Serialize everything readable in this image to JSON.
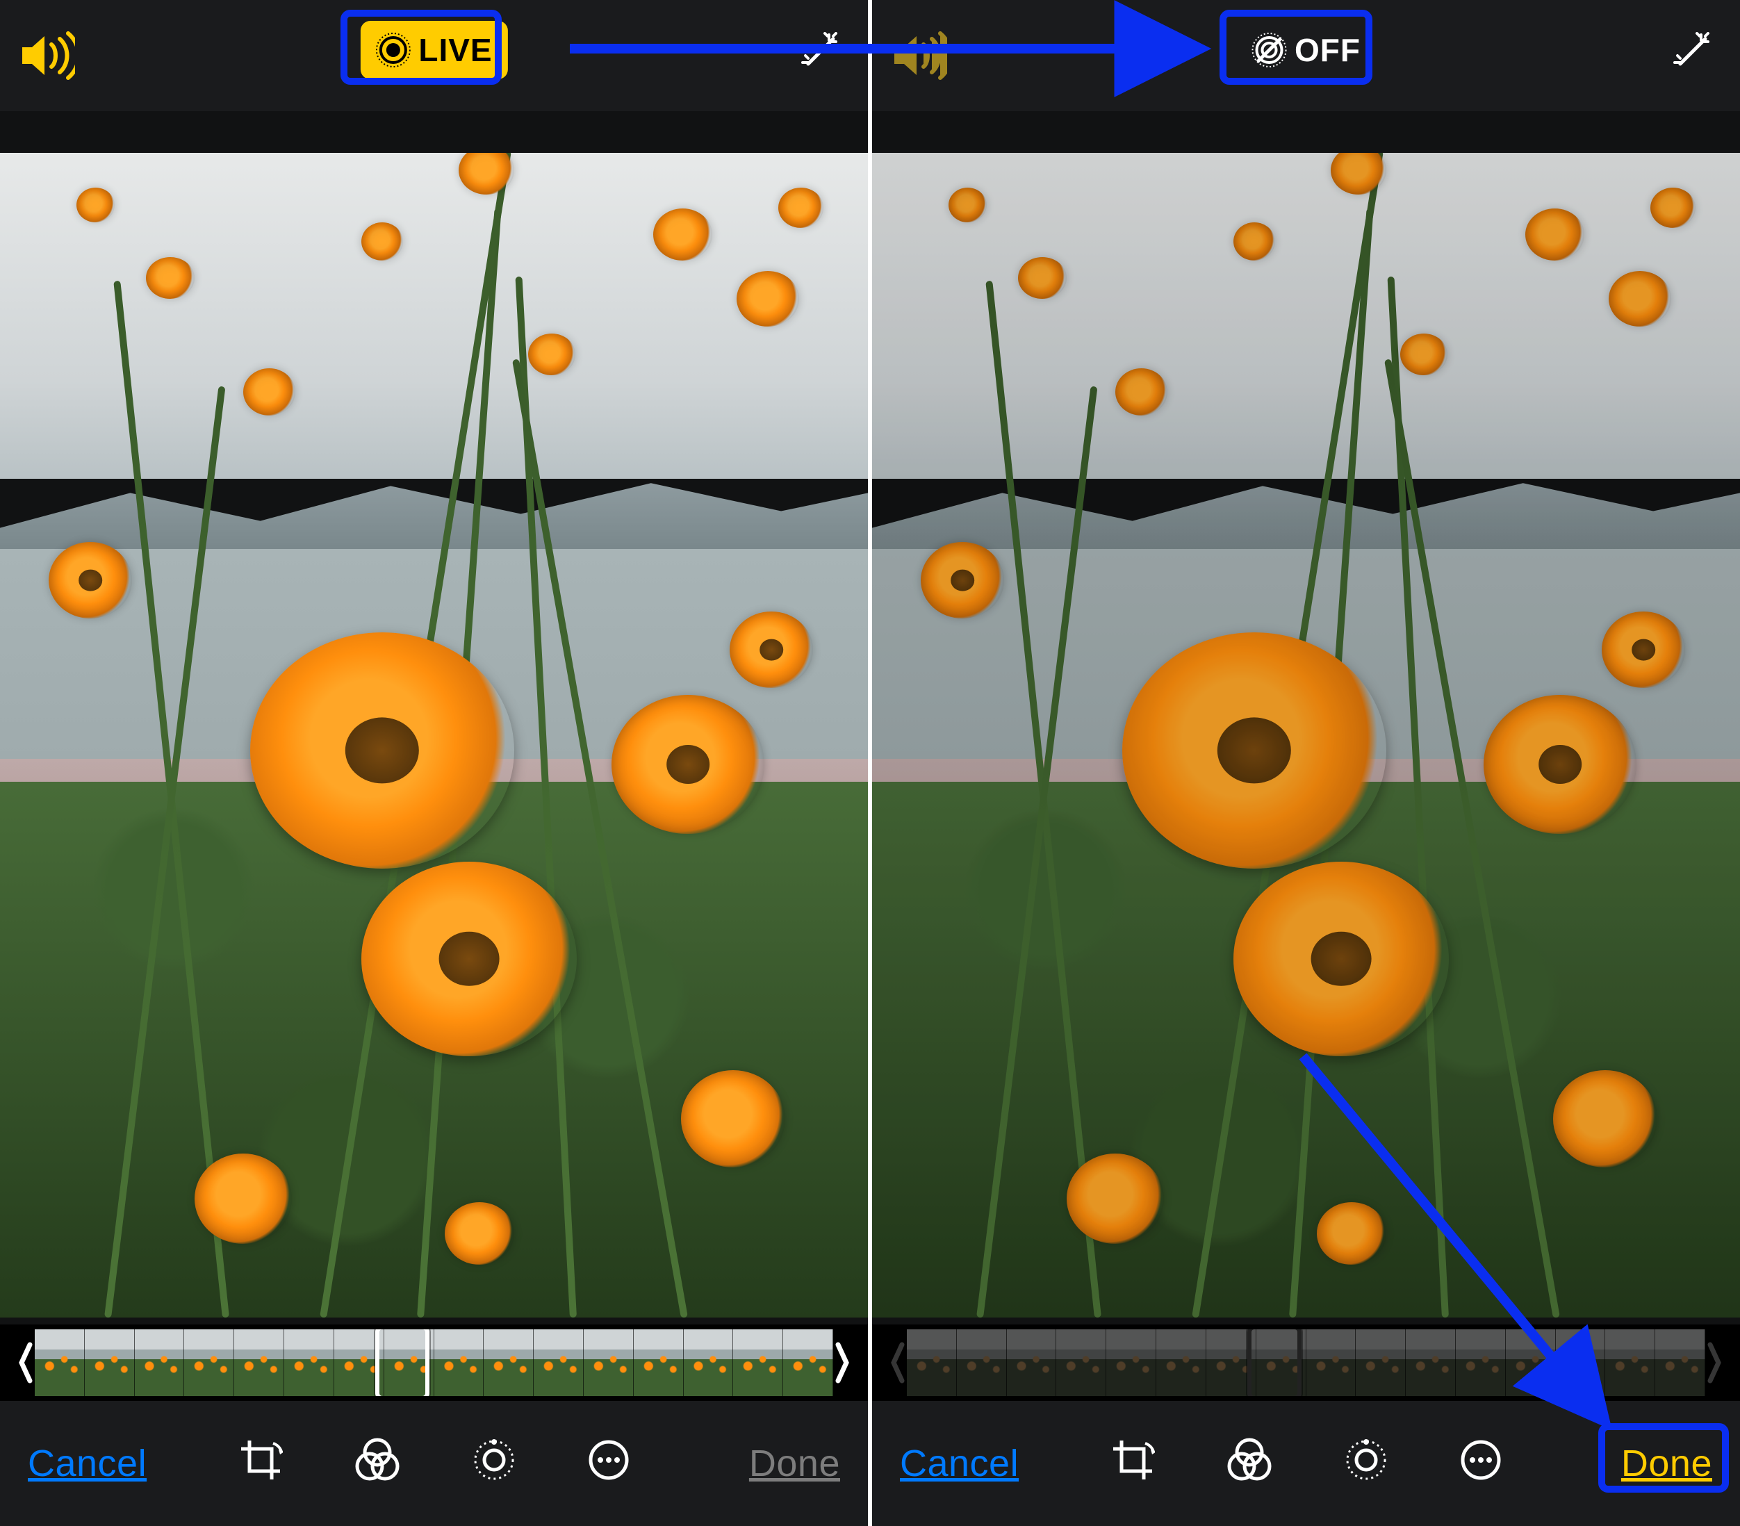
{
  "colors": {
    "yellow": "#ffcc00",
    "blue": "#007aff",
    "annotation": "#0a2ef0",
    "disabled": "#7d7d7d"
  },
  "devices": [
    {
      "id": "left",
      "live_state": "on",
      "live_label": "LIVE",
      "volume_active": true,
      "thumb_strip_active": true,
      "toolbar": {
        "cancel": "Cancel",
        "done": "Done",
        "done_active": false
      }
    },
    {
      "id": "right",
      "live_state": "off",
      "live_label": "OFF",
      "volume_active": false,
      "thumb_strip_active": false,
      "toolbar": {
        "cancel": "Cancel",
        "done": "Done",
        "done_active": true
      }
    }
  ]
}
